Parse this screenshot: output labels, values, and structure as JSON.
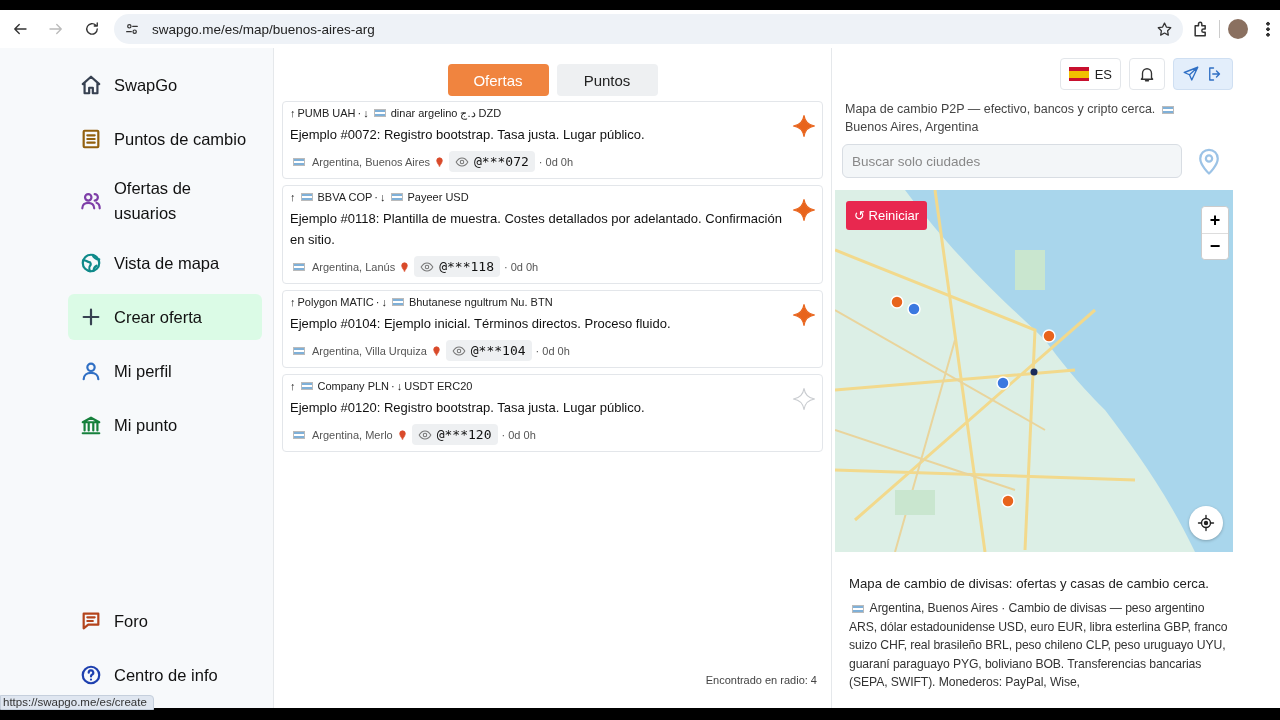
{
  "browser": {
    "url": "swapgo.me/es/map/buenos-aires-arg",
    "forward_disabled": true,
    "status_link": "https://swapgo.me/es/create"
  },
  "sidebar": {
    "items": [
      {
        "label": "SwapGo",
        "color": "#374151",
        "selected": false
      },
      {
        "label": "Puntos de cambio",
        "color": "#92600e",
        "selected": false
      },
      {
        "label": "Ofertas de usuarios",
        "color": "#7e3fa8",
        "selected": false
      },
      {
        "label": "Vista de mapa",
        "color": "#0f8a8a",
        "selected": false
      },
      {
        "label": "Crear oferta",
        "color": "#374151",
        "selected": true
      },
      {
        "label": "Mi perfil",
        "color": "#2f6fc4",
        "selected": false
      },
      {
        "label": "Mi punto",
        "color": "#16803c",
        "selected": false
      }
    ],
    "bottom_items": [
      {
        "label": "Foro",
        "color": "#b4441c",
        "selected": false
      },
      {
        "label": "Centro de info",
        "color": "#1e40af",
        "selected": false
      }
    ]
  },
  "tabs": [
    {
      "label": "Ofertas",
      "selected": true
    },
    {
      "label": "Puntos",
      "selected": false
    }
  ],
  "offers": [
    {
      "from": {
        "arrow": "↑",
        "flag": false,
        "text": "PUMB UAH"
      },
      "separator": "·",
      "to": {
        "arrow": "↓",
        "flag": true,
        "text": "dinar argelino د.ج DZD"
      },
      "title": "Ejemplo #0072: Registro bootstrap. Tasa justa. Lugar público.",
      "location": "Argentina, Buenos Aires",
      "handle": "@***072",
      "age": "· 0d 0h",
      "featured": true
    },
    {
      "from": {
        "arrow": "↑",
        "flag": true,
        "text": "BBVA COP"
      },
      "separator": "·",
      "to": {
        "arrow": "↓",
        "flag": true,
        "text": "Payeer USD"
      },
      "title": "Ejemplo #0118: Plantilla de muestra. Costes detallados por adelantado. Confirmación en sitio.",
      "location": "Argentina, Lanús",
      "handle": "@***118",
      "age": "· 0d 0h",
      "featured": true
    },
    {
      "from": {
        "arrow": "↑",
        "flag": false,
        "text": "Polygon MATIC"
      },
      "separator": "·",
      "to": {
        "arrow": "↓",
        "flag": true,
        "text": "Bhutanese ngultrum Nu. BTN"
      },
      "title": "Ejemplo #0104: Ejemplo inicial. Términos directos. Proceso fluido.",
      "location": "Argentina, Villa Urquiza",
      "handle": "@***104",
      "age": "· 0d 0h",
      "featured": true
    },
    {
      "from": {
        "arrow": "↑",
        "flag": true,
        "text": "Company PLN"
      },
      "separator": "·",
      "to": {
        "arrow": "↓",
        "flag": false,
        "text": "USDT ERC20"
      },
      "title": "Ejemplo #0120: Registro bootstrap. Tasa justa. Lugar público.",
      "location": "Argentina, Merlo",
      "handle": "@***120",
      "age": "· 0d 0h",
      "featured": false
    }
  ],
  "found": "Encontrado en radio: 4",
  "header": {
    "language": "ES"
  },
  "description": {
    "text": "Mapa de cambio P2P — efectivo, bancos y cripto cerca.",
    "place": "Buenos Aires, Argentina"
  },
  "search": {
    "placeholder": "Buscar solo ciudades"
  },
  "map": {
    "kind": "picture",
    "reset_label": "↺ Reiniciar",
    "zoom_in": "+",
    "zoom_out": "−"
  },
  "info": {
    "heading": "Mapa de cambio de divisas: ofertas y casas de cambio cerca.",
    "text": "Argentina, Buenos Aires · Cambio de divisas — peso argentino ARS, dólar estadounidense USD, euro EUR, libra esterlina GBP, franco suizo CHF, real brasileño BRL, peso chileno CLP, peso uruguayo UYU, guaraní paraguayo PYG, boliviano BOB. Transferencias bancarias (SEPA, SWIFT). Monederos: PayPal, Wise,"
  }
}
